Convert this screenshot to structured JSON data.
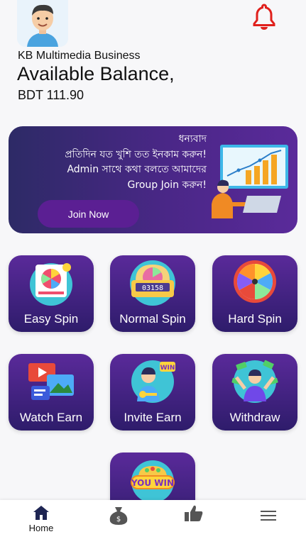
{
  "header": {
    "company_name": "KB Multimedia Business",
    "balance_title": "Available Balance,",
    "balance_value": "BDT 111.90",
    "notification_color": "#e0201c"
  },
  "banner": {
    "lines": [
      "ধন্যবাদ",
      "প্রতিদিন যত খুশি তত ইনকাম করুন!",
      "Admin সাথে কথা বলতে আমাদের",
      "Group Join করুন!"
    ],
    "button_label": "Join Now"
  },
  "cards": [
    {
      "label": "Easy Spin",
      "icon": "easy-spin-icon"
    },
    {
      "label": "Normal Spin",
      "icon": "slot-machine-icon"
    },
    {
      "label": "Hard Spin",
      "icon": "spin-wheel-icon"
    },
    {
      "label": "Watch Earn",
      "icon": "video-icon"
    },
    {
      "label": "Invite Earn",
      "icon": "invite-icon"
    },
    {
      "label": "Withdraw",
      "icon": "money-icon"
    },
    {
      "label": "",
      "icon": "you-win-icon",
      "badge_text": "YOU WIN"
    }
  ],
  "nav": {
    "home_label": "Home",
    "active_color": "#1e2553"
  }
}
